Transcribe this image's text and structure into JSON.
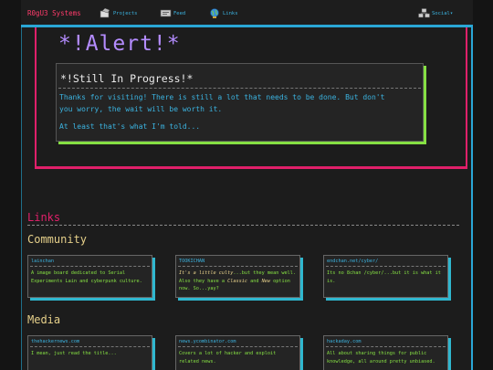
{
  "nav": {
    "brand": "R0gU3 Systems",
    "projects": "Projects",
    "feed": "Feed",
    "links": "Links",
    "social": "Social▾"
  },
  "alert": {
    "title": "*!Alert!*",
    "card_title": "*!Still In Progress!*",
    "line1": "Thanks for visiting! There is still a lot that needs to be done. But don't",
    "line2": "you worry, the wait will be worth it.",
    "line3": "At least that's what I'm told..."
  },
  "links": {
    "title": "Links",
    "community": {
      "title": "Community",
      "cards": [
        {
          "head": "lainchan",
          "body": "A image board dedicated to Serial Experiments Lain and cyberpunk culture."
        },
        {
          "head": "TOOKICHAN",
          "body_parts": [
            "It's a little culty",
            "...but they mean well. Also they have a ",
            "Classic",
            " and ",
            "New",
            " option now. So...yay?"
          ]
        },
        {
          "head": "endchan.net/cyber/",
          "body": "Its no 8chan /cyber/...but it is what it is."
        }
      ]
    },
    "media": {
      "title": "Media",
      "cards": [
        {
          "head": "thehackernews.com",
          "body": "I mean, just read the title..."
        },
        {
          "head": "news.ycombinator.com",
          "body": "Covers a lot of hacker and exploit related news."
        },
        {
          "head": "hackaday.com",
          "body": "All about sharing things for public knowledge, all around pretty unbiased."
        }
      ]
    }
  }
}
